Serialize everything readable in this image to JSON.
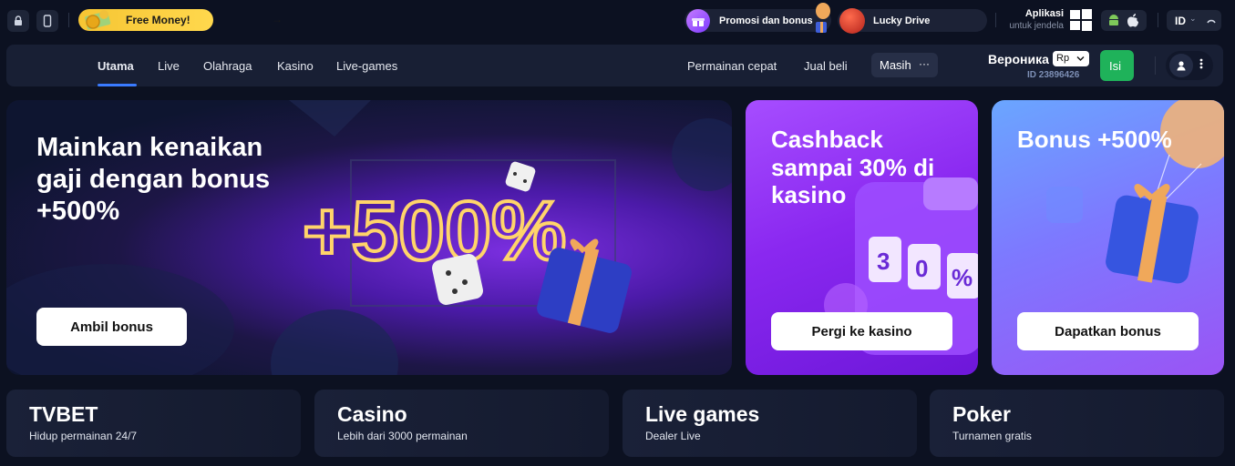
{
  "topbar": {
    "free_money_label": "Free Money!",
    "free_money_arrow": "→",
    "promo_label": "Promosi dan bonus",
    "lucky_label": "Lucky Drive",
    "app_title": "Aplikasi",
    "app_subtitle": "untuk jendela",
    "language": "ID",
    "language_chevron": "⌄"
  },
  "nav": {
    "items": [
      {
        "label": "Utama",
        "active": true
      },
      {
        "label": "Live"
      },
      {
        "label": "Olahraga"
      },
      {
        "label": "Kasino"
      },
      {
        "label": "Live-games"
      }
    ],
    "right_items": [
      {
        "label": "Permainan cepat"
      },
      {
        "label": "Jual beli"
      }
    ],
    "more_label": "Masih",
    "more_dots": "···"
  },
  "account": {
    "name": "Вероника",
    "currency": "Rp",
    "id_text": "ID 23896426",
    "deposit_label": "Isi"
  },
  "banners": {
    "main": {
      "title": "Mainkan kenaikan gaji dengan bonus +500%",
      "button": "Ambil bonus",
      "graphic_text": "+500%"
    },
    "cashback": {
      "title": "Cashback sampai 30% di kasino",
      "button": "Pergi ke kasino"
    },
    "bonus": {
      "title": "Bonus +500%",
      "button": "Dapatkan bonus"
    }
  },
  "categories": [
    {
      "title": "TVBET",
      "subtitle": "Hidup permainan 24/7"
    },
    {
      "title": "Casino",
      "subtitle": "Lebih dari 3000 permainan"
    },
    {
      "title": "Live games",
      "subtitle": "Dealer Live"
    },
    {
      "title": "Poker",
      "subtitle": "Turnamen gratis"
    }
  ],
  "colors": {
    "background": "#0c1121",
    "accent_blue": "#3a7bff",
    "deposit_green": "#1fb25a",
    "free_money_yellow": "#f6c533"
  }
}
